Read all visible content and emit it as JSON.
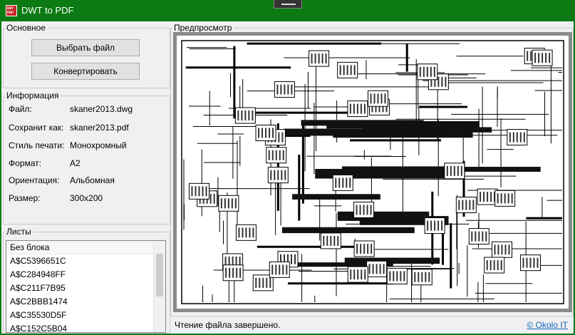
{
  "window": {
    "title": "DWT to PDF",
    "icon_text": [
      "DWT",
      "PDF"
    ]
  },
  "main_group": {
    "legend": "Основное",
    "select_file_label": "Выбрать файл",
    "convert_label": "Конвертировать"
  },
  "info_group": {
    "legend": "Информация",
    "rows": [
      {
        "label": "Файл:",
        "value": "skaner2013.dwg"
      },
      {
        "label": "Сохранит как:",
        "value": "skaner2013.pdf"
      },
      {
        "label": "Стиль печати:",
        "value": "Монохромный"
      },
      {
        "label": "Формат:",
        "value": "A2"
      },
      {
        "label": "Ориентация:",
        "value": "Альбомная"
      },
      {
        "label": "Размер:",
        "value": "300x200"
      }
    ]
  },
  "sheets_group": {
    "legend": "Листы",
    "items": [
      "Без блока",
      "A$C5396651C",
      "A$C284948FF",
      "A$C211F7B95",
      "A$C2BBB1474",
      "A$C35530D5F",
      "A$C152C5B04"
    ]
  },
  "preview_group": {
    "legend": "Предпросмотр"
  },
  "status": {
    "text": "Чтение файла завершено.",
    "link": "© Okolo IT"
  },
  "colors": {
    "titlebar": "#0b7a12",
    "link": "#1565c0"
  }
}
